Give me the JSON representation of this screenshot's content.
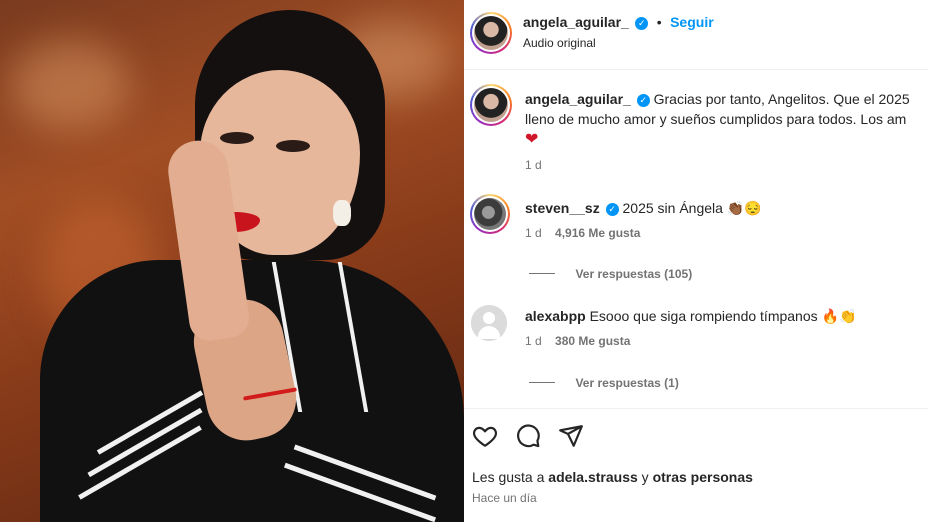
{
  "post": {
    "author": "angela_aguilar_",
    "follow_label": "Seguir",
    "separator": "•",
    "audio": "Audio original"
  },
  "caption": {
    "author": "angela_aguilar_",
    "line1": "Gracias por tanto, Angelitos. Que el 2025",
    "line2": "lleno de mucho amor y sueños cumplidos para todos. Los am",
    "heart": "❤",
    "time": "1 d"
  },
  "comments": [
    {
      "author": "steven__sz",
      "verified": true,
      "text": "2025 sin Ángela",
      "emoji": "👏🏾😔",
      "time": "1 d",
      "likes": "4,916 Me gusta",
      "replies": "Ver respuestas (105)"
    },
    {
      "author": "alexabpp",
      "verified": false,
      "text": "Esooo que siga rompiendo tímpanos",
      "emoji": "🔥👏",
      "time": "1 d",
      "likes": "380 Me gusta",
      "replies": "Ver respuestas (1)"
    }
  ],
  "footer": {
    "likes_prefix": "Les gusta a",
    "likes_user": "adela.strauss",
    "likes_mid": "y",
    "likes_others": "otras personas",
    "time": "Hace un día"
  },
  "icons": [
    "heart-outline-icon",
    "comment-icon",
    "share-icon",
    "verified-badge-icon"
  ],
  "colors": {
    "accent": "#0095f6",
    "muted": "#737373",
    "text": "#262626",
    "lips": "#c8141c"
  }
}
